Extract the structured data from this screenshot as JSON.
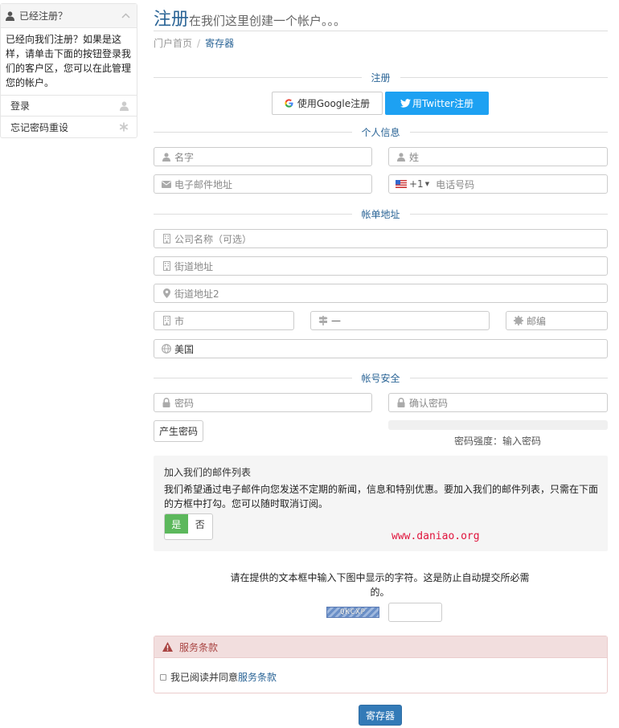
{
  "sidebar": {
    "header": "已经注册？",
    "description": "已经向我们注册？如果是这样，请单击下面的按钮登录我们的客户区，您可以在此管理您的帐户。",
    "items": [
      {
        "label": "登录",
        "icon": "user-icon"
      },
      {
        "label": "忘记密码重设",
        "icon": "asterisk-icon"
      }
    ]
  },
  "header": {
    "title": "注册",
    "subtitle": "在我们这里创建一个帐户。。。",
    "breadcrumb": {
      "home": "门户首页",
      "current": "寄存器"
    }
  },
  "sections": {
    "register": "注册",
    "personal": "个人信息",
    "billing": "帐单地址",
    "security": "帐号安全"
  },
  "social": {
    "google_label": "使用Google注册",
    "twitter_label": "用Twitter注册"
  },
  "form": {
    "first_name": "名字",
    "last_name": "姓",
    "email": "电子邮件地址",
    "phone_code": "+1",
    "phone": "电话号码",
    "company": "公司名称（可选）",
    "address1": "街道地址",
    "address2": "街道地址2",
    "city": "市",
    "state": "—",
    "postcode": "邮编",
    "country": "美国",
    "password": "密码",
    "confirm_password": "确认密码",
    "generate_password": "产生密码",
    "password_strength": "密码强度：输入密码"
  },
  "mailing": {
    "title": "加入我们的邮件列表",
    "text": "我们希望通过电子邮件向您发送不定期的新闻，信息和特别优惠。要加入我们的邮件列表，只需在下面的方框中打勾。您可以随时取消订阅。",
    "yes": "是",
    "no": "否",
    "watermark": "www.daniao.org"
  },
  "captcha": {
    "text": "请在提供的文本框中输入下图中显示的字符。这是防止自动提交所必需的。",
    "code": "QKCXP"
  },
  "terms": {
    "title": "服务条款",
    "agree_prefix": "我已阅读并同意",
    "agree_link": "服务条款"
  },
  "submit_label": "寄存器",
  "colors": {
    "accent": "#2a6496",
    "primary_button": "#337ab7",
    "twitter": "#1da1f2",
    "yes_toggle": "#5cb85c",
    "terms_header_bg": "#f2dede",
    "terms_header_text": "#a94442"
  }
}
